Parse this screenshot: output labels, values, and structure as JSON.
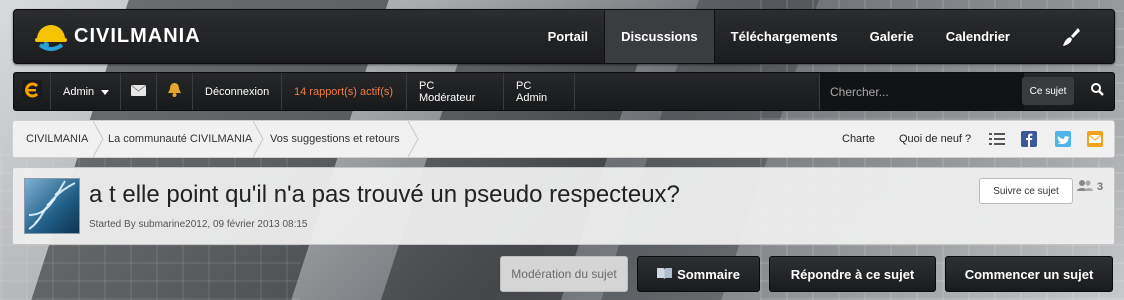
{
  "site": {
    "name": "CIVILMANIA"
  },
  "nav": {
    "items": [
      {
        "label": "Portail"
      },
      {
        "label": "Discussions"
      },
      {
        "label": "Téléchargements"
      },
      {
        "label": "Galerie"
      },
      {
        "label": "Calendrier"
      }
    ],
    "active": "Discussions",
    "theme_icon": "paint-brush-icon"
  },
  "userbar": {
    "user": "Admin",
    "logout": "Déconnexion",
    "reports": "14 rapport(s) actif(s)",
    "moderator_cp": "PC Modérateur",
    "admin_cp": "PC Admin",
    "search_placeholder": "Chercher...",
    "search_scope": "Ce sujet"
  },
  "breadcrumb": {
    "items": [
      {
        "label": "CIVILMANIA"
      },
      {
        "label": "La communauté CIVILMANIA"
      },
      {
        "label": "Vos suggestions et retours"
      }
    ],
    "right_links": [
      {
        "label": "Charte"
      },
      {
        "label": "Quoi de neuf ?"
      }
    ]
  },
  "topic": {
    "title": "a t elle point qu'il n'a pas trouvé un pseudo respecteux?",
    "meta": "Started By submarine2012, 09 février 2013 08:15",
    "follow_label": "Suivre ce sujet",
    "followers_count": "3"
  },
  "actions": {
    "moderation": "Modération du sujet",
    "summary": "Sommaire",
    "reply": "Répondre à ce sujet",
    "new_topic": "Commencer un sujet"
  },
  "colors": {
    "accent": "#f07d45",
    "bar_dark": "#1b1c1e",
    "logo_yellow": "#f5c400",
    "logo_blue": "#2a9fd6"
  }
}
